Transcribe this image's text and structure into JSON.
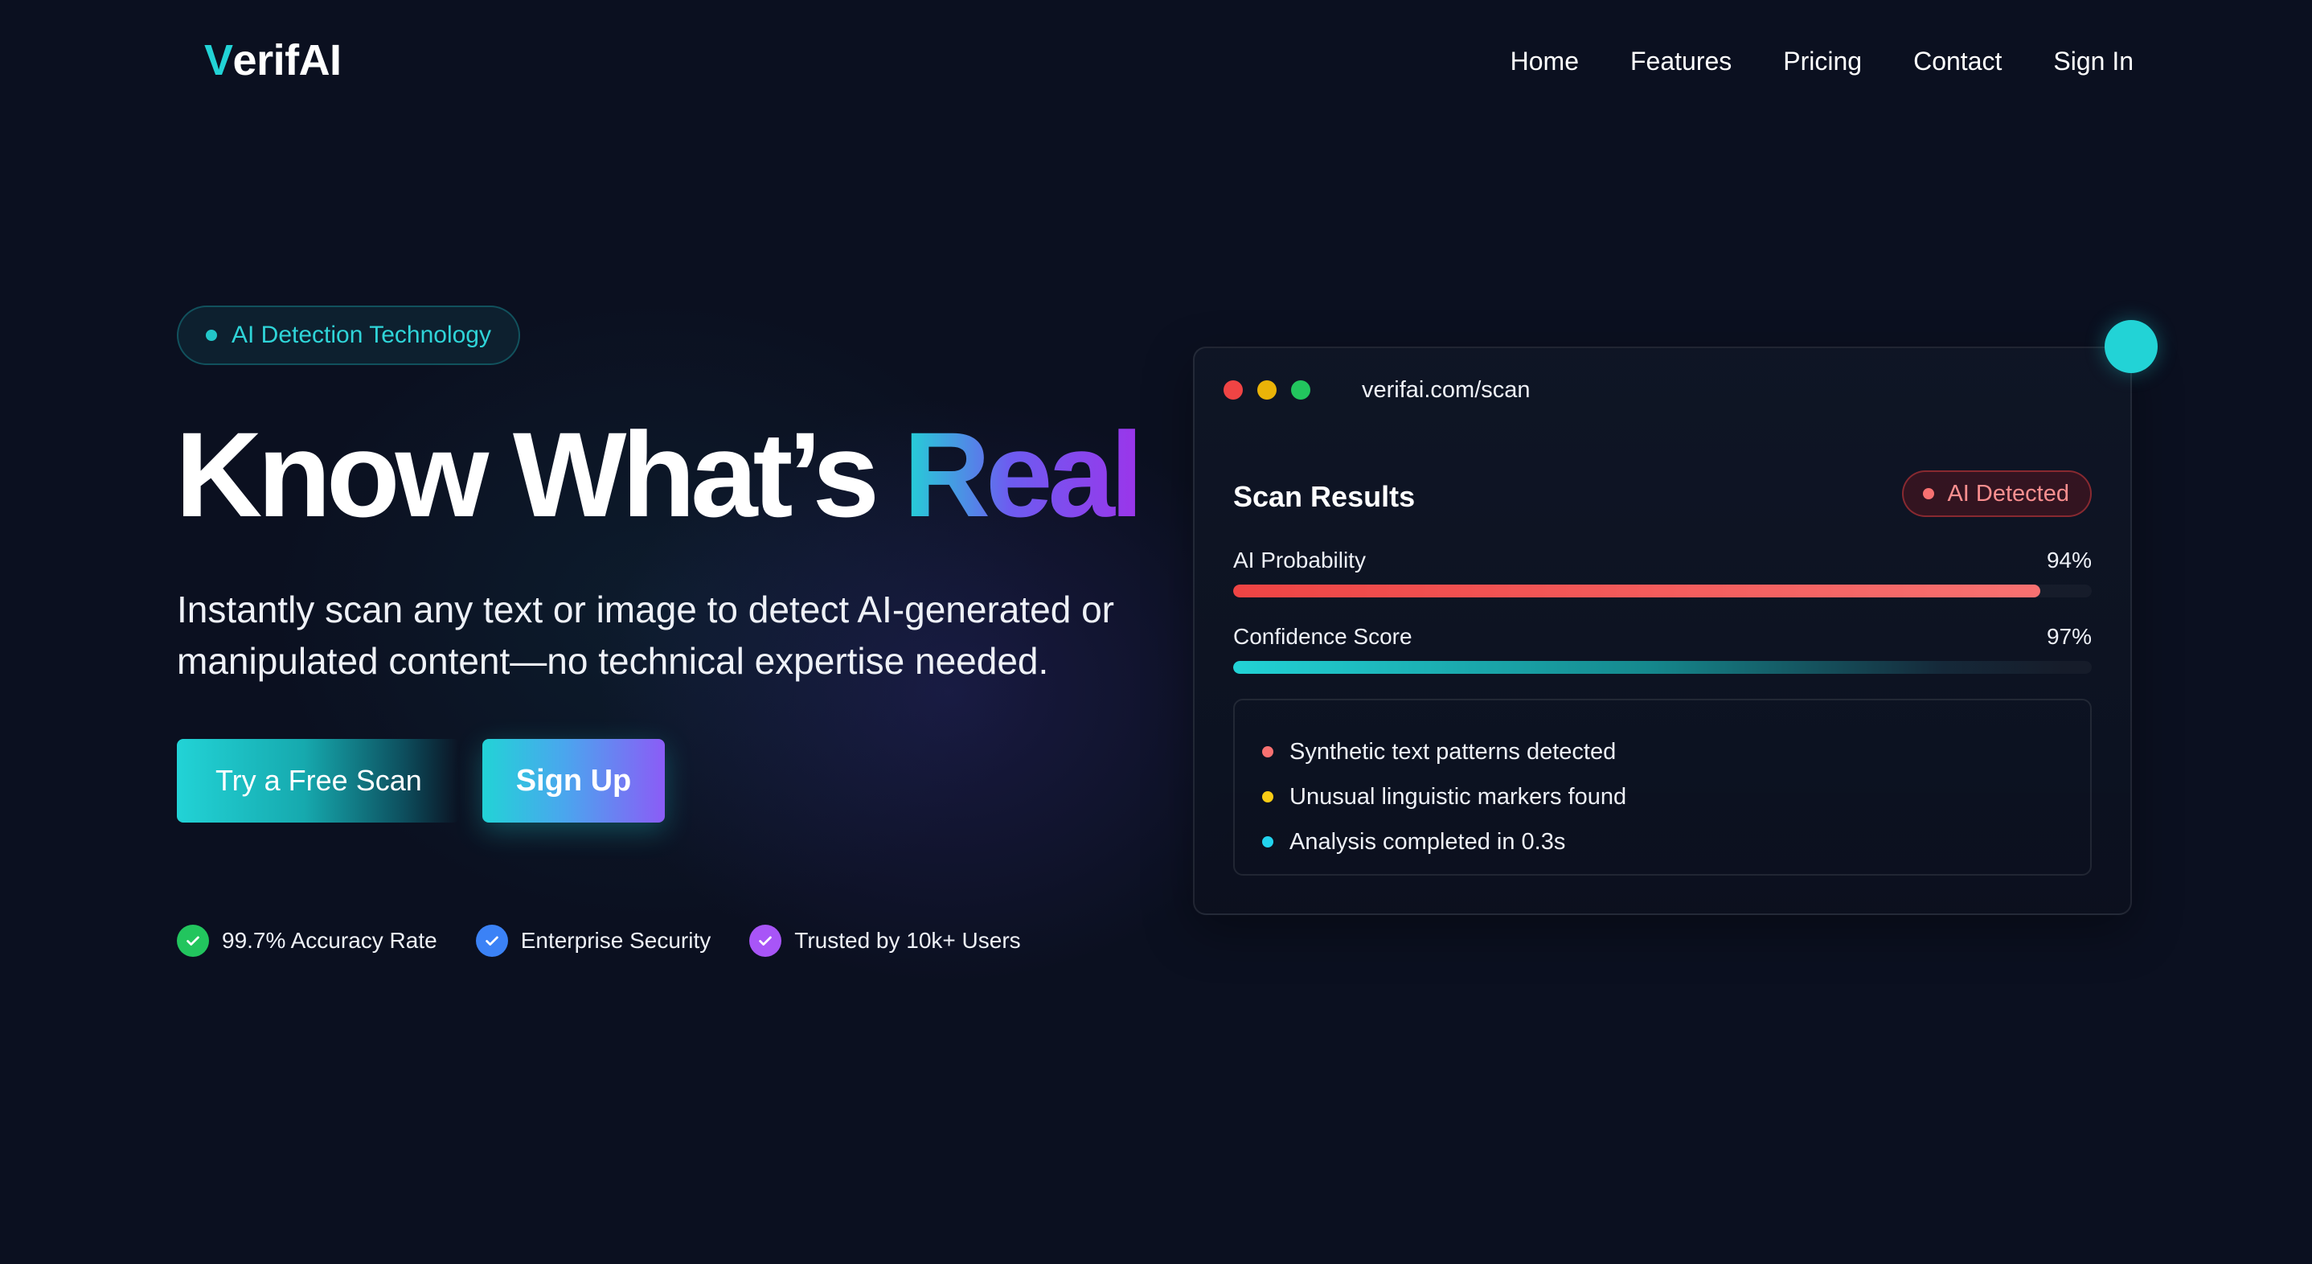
{
  "nav": {
    "logo_v": "V",
    "logo_rest": "erifAI",
    "links": [
      "Home",
      "Features",
      "Pricing",
      "Contact",
      "Sign In"
    ]
  },
  "hero": {
    "badge": "AI Detection Technology",
    "headline_main": "Know What’s ",
    "headline_accent": "Real",
    "subhead": "Instantly scan any text or image to detect AI-generated or manipulated content—no technical expertise needed.",
    "cta_primary": "Try a Free Scan",
    "cta_secondary": "Sign Up",
    "trust": [
      {
        "label": "99.7% Accuracy Rate",
        "color": "#22c55e"
      },
      {
        "label": "Enterprise Security",
        "color": "#3b82f6"
      },
      {
        "label": "Trusted by 10k+ Users",
        "color": "#a855f7"
      }
    ]
  },
  "scan_card": {
    "url": "verifai.com/scan",
    "title": "Scan Results",
    "status_badge": "AI Detected",
    "metrics": [
      {
        "label": "AI Probability",
        "value": "94%",
        "fraction": 0.94
      },
      {
        "label": "Confidence Score",
        "value": "97%",
        "fraction": 0.97
      }
    ],
    "findings": [
      {
        "text": "Synthetic text patterns detected",
        "color": "#f87171"
      },
      {
        "text": "Unusual linguistic markers found",
        "color": "#facc15"
      },
      {
        "text": "Analysis completed in 0.3s",
        "color": "#22d3ee"
      }
    ]
  },
  "colors": {
    "background": "#0b1020",
    "accent": "#22d3d6",
    "accent_purple": "#9b35ea"
  }
}
